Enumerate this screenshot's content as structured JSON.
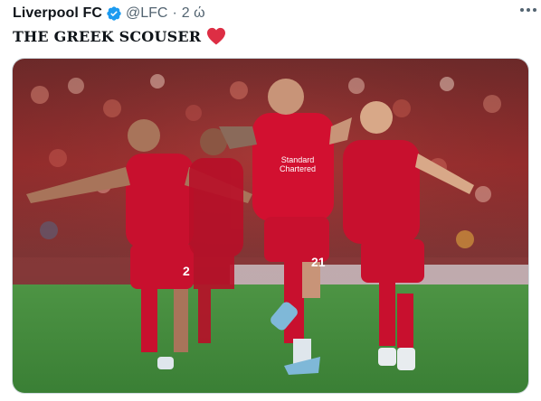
{
  "tweet": {
    "display_name": "Liverpool FC",
    "handle": "@LFC",
    "separator": "·",
    "time": "2 ώ",
    "text": "THE GREEK SCOUSER",
    "emoji": "red-heart"
  },
  "media": {
    "description_icon": "photo",
    "jersey_text": "Standard Chartered",
    "shorts_number_left": "2",
    "shorts_number_center": "21"
  },
  "colors": {
    "verified": "#1d9bf0",
    "heart": "#e0245e",
    "kit_red": "#c8102e",
    "pitch": "#3f8a3a"
  }
}
